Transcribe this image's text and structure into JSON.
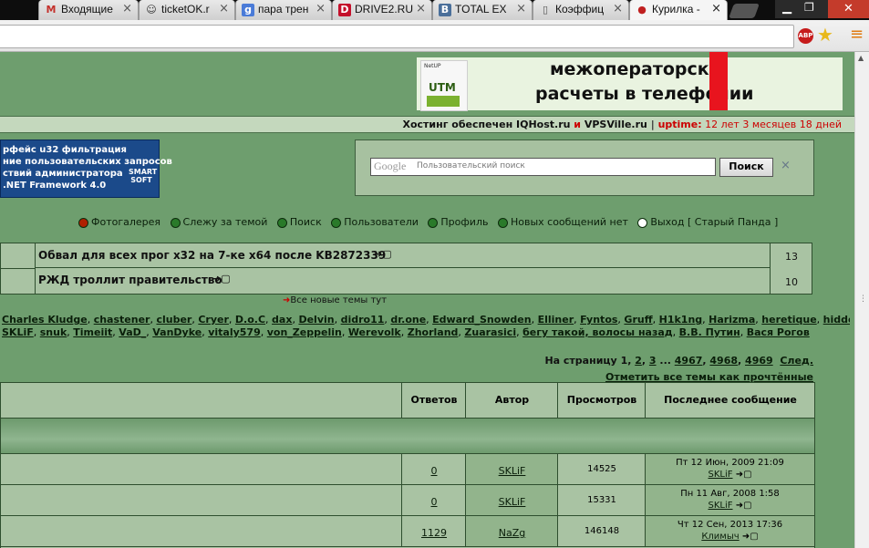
{
  "tabs": [
    {
      "label": "Входящие",
      "icon": "gmail-icon",
      "glyph": "M"
    },
    {
      "label": "ticketOK.r",
      "icon": "ticket-icon",
      "glyph": "☺"
    },
    {
      "label": "пара трен",
      "icon": "google-icon",
      "glyph": "g"
    },
    {
      "label": "DRIVE2.RU",
      "icon": "drive2-icon",
      "glyph": "D"
    },
    {
      "label": "TOTAL EX",
      "icon": "vk-icon",
      "glyph": "B"
    },
    {
      "label": "Коэффиц",
      "icon": "page-icon",
      "glyph": "▯"
    },
    {
      "label": "Курилка -",
      "icon": "kurilka-icon",
      "glyph": "●"
    }
  ],
  "tab_close": "×",
  "toolbar": {
    "abp": "ABP",
    "star": "★",
    "menu": "≡"
  },
  "banner": {
    "logo_top": "NetUP",
    "logo_mid": "UTM",
    "line1": "межоператорск",
    "line2": "расчеты в телефонии"
  },
  "hosting": {
    "prefix": "Хостинг обеспечен ",
    "host1": "IQHost.ru",
    "and": " и ",
    "host2": "VPSVille.ru",
    "sep": " | ",
    "uptime_label": "uptime:",
    "uptime_value": " 12 лет 3 месяцев 18 дней"
  },
  "ad": {
    "lines": [
      "рфейс    u32 фильтрация",
      "ние пользовательских запросов",
      "ствий администратора",
      ".NET Framework 4.0"
    ],
    "logo": "SMART SOFT"
  },
  "search": {
    "placeholder": "Пользовательский поиск",
    "google": "Google",
    "button": "Поиск",
    "clear": "×"
  },
  "nav": [
    {
      "label": "Фотогалерея",
      "color": "#b02000"
    },
    {
      "label": "Слежу за темой",
      "color": "#1a6a1a"
    },
    {
      "label": "Поиск",
      "color": "#1a6a1a"
    },
    {
      "label": "Пользователи",
      "color": "#1a6a1a"
    },
    {
      "label": "Профиль",
      "color": "#1a6a1a"
    },
    {
      "label": "Новых сообщений нет",
      "color": "#1a6a1a"
    },
    {
      "label": "Выход [ Старый Панда ]",
      "color": "#1a6a1a"
    }
  ],
  "hot_topics": [
    {
      "title": "Обвал для всех прог х32 на 7-ке х64 после KB2872339",
      "count": "13"
    },
    {
      "title": "РЖД троллит правительство",
      "count": "10"
    }
  ],
  "all_new": "Все новые темы тут",
  "online_users": [
    "Charles Kludge",
    "chastener",
    "cluber",
    "Cryer",
    "D.o.C",
    "dax",
    "Delvin",
    "didro11",
    "dr.one",
    "Edward_Snowden",
    "Elliner",
    "Fyntos",
    "Gruff",
    "H1k1ng",
    "Harizma",
    "heretique",
    "hidden"
  ],
  "online_users2": [
    "SKLiF",
    "snuk",
    "Timeiit",
    "VaD_",
    "VanDyke",
    "vitaly579",
    "von_Zeppelin",
    "Werevolk",
    "Zhorland",
    "Zuarasici",
    "бегу такой, волосы назад",
    "В.В. Путин",
    "Вася Рогов"
  ],
  "pagination": {
    "label": "На страницу ",
    "p1": "1",
    "p2": "2",
    "p3": "3",
    "dots": " ... ",
    "p4967": "4967",
    "p4968": "4968",
    "p4969": "4969",
    "next": "След.",
    "mark_read": "Отметить все темы как прочтённые"
  },
  "columns": {
    "replies": "Ответов",
    "author": "Автор",
    "views": "Просмотров",
    "last": "Последнее сообщение"
  },
  "rows": [
    {
      "replies": "0",
      "author": "SKLiF",
      "views": "14525",
      "last_date": "Пт 12 Июн, 2009 21:09",
      "last_user": "SKLiF"
    },
    {
      "replies": "0",
      "author": "SKLiF",
      "views": "15331",
      "last_date": "Пн 11 Авг, 2008 1:58",
      "last_user": "SKLiF"
    },
    {
      "replies": "1129",
      "author": "NaZg",
      "views": "146148",
      "last_date": "Чт 12 Сен, 2013 17:36",
      "last_user": "Климыч"
    }
  ],
  "post_icon": "➜▢"
}
